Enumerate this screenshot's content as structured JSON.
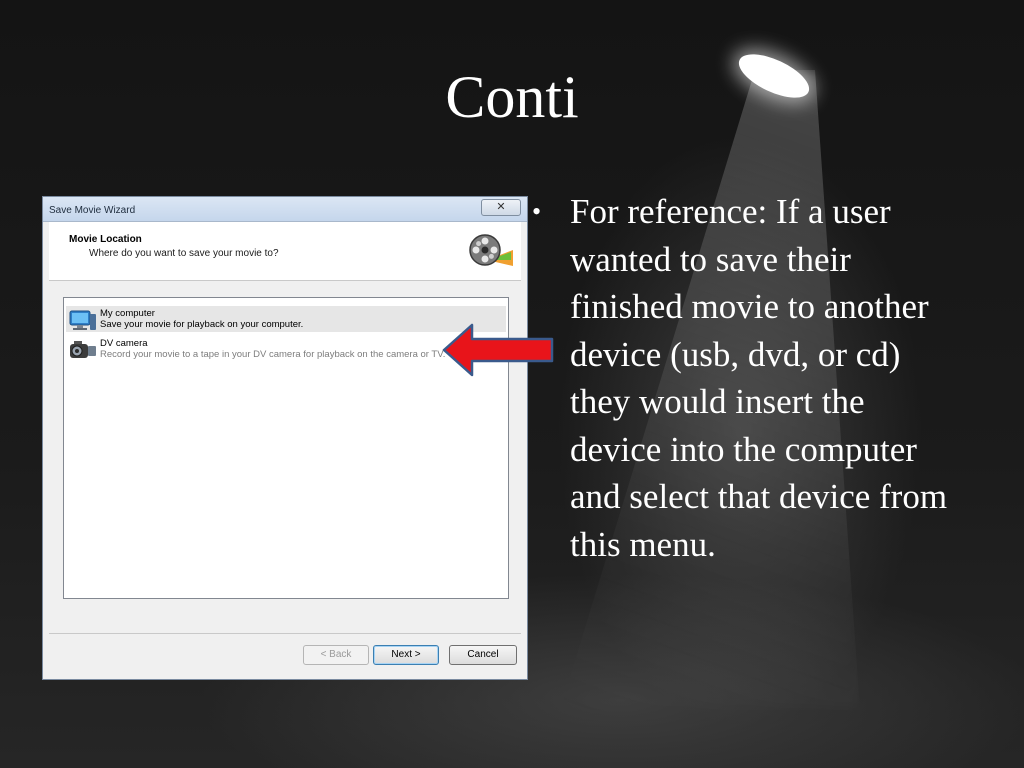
{
  "slide": {
    "title": "Conti",
    "bullets": [
      "For reference:  If a user wanted to save their finished movie to another device (usb, dvd, or cd) they would insert the device into the computer and select that device from this menu."
    ]
  },
  "dialog": {
    "title": "Save Movie Wizard",
    "close_label": "✕",
    "header": {
      "title": "Movie Location",
      "subtitle": "Where do you want to save your movie to?",
      "icon": "film-reel-icon"
    },
    "options": [
      {
        "title": "My computer",
        "description": "Save your movie for playback on your computer.",
        "icon": "computer-icon",
        "selected": true
      },
      {
        "title": "DV camera",
        "description": "Record your movie to a tape in your DV camera for playback on the camera or TV.",
        "icon": "camcorder-icon",
        "selected": false
      }
    ],
    "buttons": {
      "back": "< Back",
      "next": "Next >",
      "cancel": "Cancel"
    }
  },
  "colors": {
    "arrow_fill": "#e8141a",
    "arrow_outline": "#3a5a8c",
    "background": "#101010"
  },
  "annotation": {
    "icon": "red-arrow-left-icon"
  }
}
